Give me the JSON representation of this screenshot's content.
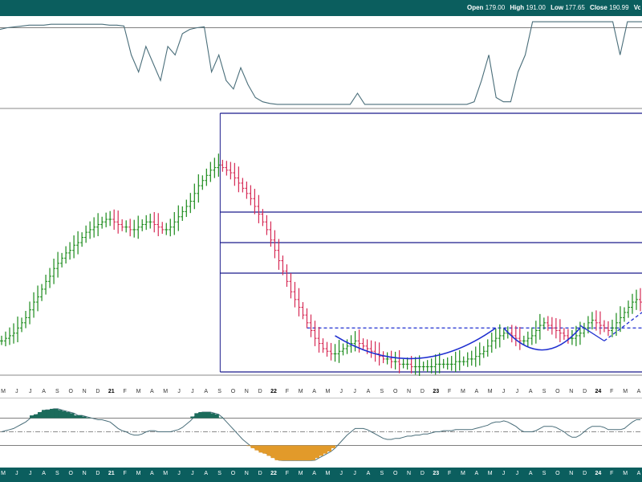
{
  "header": {
    "open_label": "Open",
    "open": "179.00",
    "high_label": "High",
    "high": "191.00",
    "low_label": "Low",
    "low": "177.65",
    "close_label": "Close",
    "close": "190.99",
    "volume_label": "Volu"
  },
  "axis_months": [
    "M",
    "J",
    "J",
    "A",
    "S",
    "O",
    "N",
    "D",
    "21",
    "F",
    "M",
    "A",
    "M",
    "J",
    "J",
    "A",
    "S",
    "O",
    "N",
    "D",
    "22",
    "F",
    "M",
    "A",
    "M",
    "J",
    "J",
    "A",
    "S",
    "O",
    "N",
    "D",
    "23",
    "F",
    "M",
    "A",
    "M",
    "J",
    "J",
    "A",
    "S",
    "O",
    "N",
    "D",
    "24",
    "F",
    "M",
    "A"
  ],
  "colors": {
    "bar_up": "#1a8a1a",
    "bar_down": "#d62a55",
    "level_line": "#1a1a8c",
    "pattern_line": "#1f2fd0",
    "oscillator": "#4a6e7a",
    "osc_fill_up": "#1b6b5b",
    "osc_fill_down": "#e29a2a",
    "bar_bg": "#0b5e5e"
  },
  "chart_data": {
    "type": "ohlc",
    "periods": 220,
    "note_series": "price path sampled at weekly intervals",
    "price": [
      12,
      13,
      14,
      15,
      17,
      19,
      21,
      24,
      27,
      29,
      32,
      35,
      37,
      40,
      42,
      44,
      46,
      47,
      49,
      50,
      52,
      54,
      55,
      56,
      57,
      58,
      59,
      59,
      58,
      57,
      56,
      56,
      55,
      55,
      56,
      57,
      58,
      58,
      57,
      56,
      55,
      55,
      56,
      58,
      60,
      62,
      64,
      66,
      69,
      72,
      74,
      76,
      78,
      79,
      80,
      79,
      78,
      77,
      75,
      73,
      71,
      69,
      67,
      64,
      61,
      58,
      55,
      51,
      47,
      43,
      39,
      35,
      31,
      28,
      25,
      22,
      19,
      16,
      13,
      11,
      9,
      8,
      7,
      7,
      8,
      9,
      10,
      11,
      12,
      11,
      10,
      9,
      8,
      7,
      6,
      5,
      5,
      4,
      4,
      3,
      3,
      3,
      2,
      2,
      2,
      2,
      2,
      2,
      3,
      3,
      3,
      3,
      3,
      4,
      4,
      4,
      5,
      5,
      6,
      7,
      8,
      10,
      12,
      13,
      14,
      15,
      15,
      14,
      13,
      12,
      12,
      13,
      14,
      16,
      18,
      19,
      18,
      17,
      16,
      15,
      14,
      13,
      13,
      14,
      15,
      17,
      19,
      20,
      19,
      18,
      17,
      16,
      17,
      19,
      21,
      23,
      25,
      27,
      28,
      27
    ],
    "levels": [
      100,
      61.8,
      50,
      38.2,
      0
    ],
    "resistance_dashed": 17,
    "oscillator_top": [
      90,
      92,
      93,
      94,
      95,
      95,
      95,
      96,
      96,
      96,
      96,
      96,
      96,
      96,
      96,
      95,
      95,
      94,
      60,
      40,
      70,
      50,
      30,
      70,
      60,
      85,
      90,
      92,
      93,
      40,
      60,
      30,
      20,
      45,
      25,
      10,
      5,
      3,
      2,
      2,
      2,
      2,
      2,
      2,
      2,
      2,
      2,
      2,
      2,
      15,
      2,
      2,
      2,
      2,
      2,
      2,
      2,
      2,
      2,
      2,
      2,
      2,
      2,
      2,
      2,
      5,
      30,
      60,
      10,
      5,
      5,
      40,
      60,
      99,
      99,
      99,
      99,
      99,
      99,
      99,
      99,
      99,
      99,
      99,
      99,
      60,
      99,
      99,
      99
    ],
    "oscillator_bottom_bands": [
      70,
      50,
      30
    ]
  }
}
